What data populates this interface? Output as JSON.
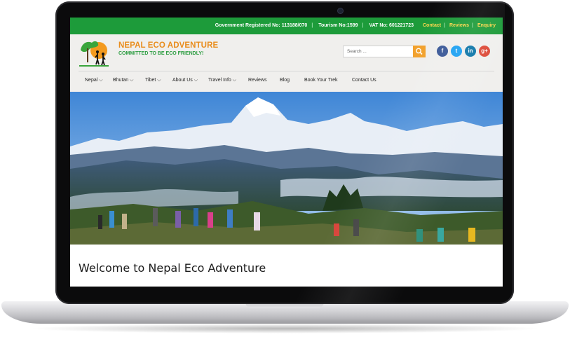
{
  "topbar": {
    "registration": "Government Registered No: 113188/070",
    "tourism": "Tourism No:1599",
    "vat": "VAT No: 601221723",
    "links": [
      "Contact",
      "Reviews",
      "Enquiry"
    ]
  },
  "brand": {
    "name": "NEPAL ECO ADVENTURE",
    "tagline": "COMMITTED TO BE ECO FRIENDLY!"
  },
  "search": {
    "placeholder": "Search ..."
  },
  "social": {
    "facebook": "f",
    "twitter": "t",
    "linkedin": "in",
    "googleplus": "g+"
  },
  "nav": {
    "items": [
      {
        "label": "Nepal",
        "dropdown": true
      },
      {
        "label": "Bhutan",
        "dropdown": true
      },
      {
        "label": "Tibet",
        "dropdown": true
      },
      {
        "label": "About Us",
        "dropdown": true
      },
      {
        "label": "Travel Info",
        "dropdown": true
      },
      {
        "label": "Reviews",
        "dropdown": false
      },
      {
        "label": "Blog",
        "dropdown": false
      },
      {
        "label": "Book Your Trek",
        "dropdown": false
      },
      {
        "label": "Contact Us",
        "dropdown": false
      }
    ]
  },
  "welcome": {
    "heading": "Welcome to Nepal Eco Adventure"
  },
  "colors": {
    "topbar": "#1d9b3a",
    "brand_orange": "#e98d1d",
    "brand_green": "#2a9c3f",
    "link_yellow": "#ffd84d"
  }
}
